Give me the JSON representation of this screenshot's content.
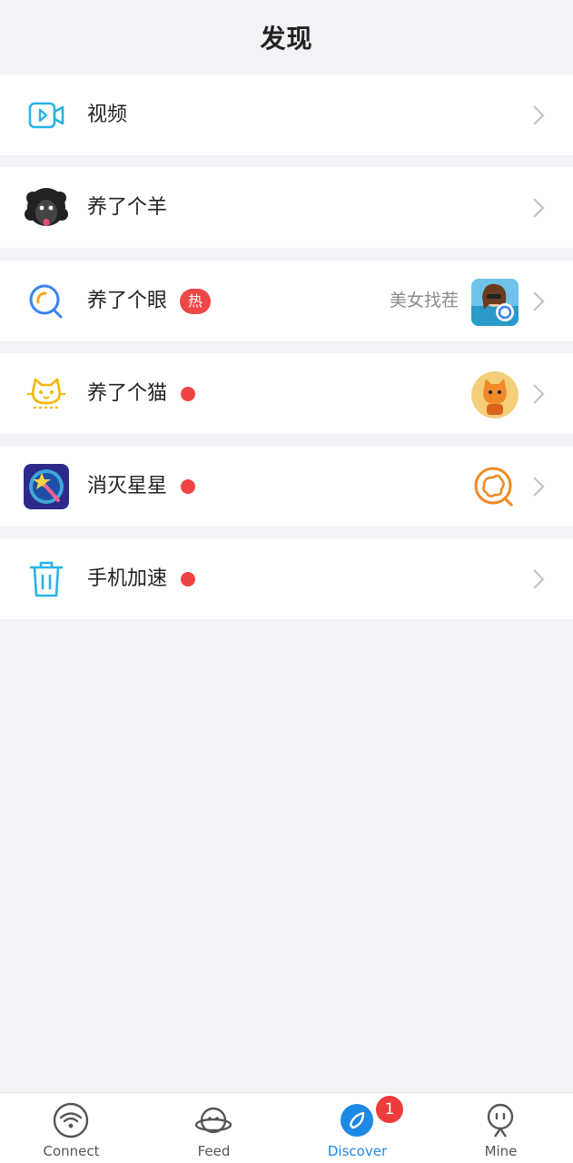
{
  "header": {
    "title": "发现"
  },
  "items": [
    {
      "label": "视频"
    },
    {
      "label": "养了个羊"
    },
    {
      "label": "养了个眼",
      "tag": "热",
      "subtitle": "美女找茬"
    },
    {
      "label": "养了个猫"
    },
    {
      "label": "消灭星星"
    },
    {
      "label": "手机加速"
    }
  ],
  "tabs": [
    {
      "label": "Connect"
    },
    {
      "label": "Feed"
    },
    {
      "label": "Discover",
      "badge": "1"
    },
    {
      "label": "Mine"
    }
  ],
  "colors": {
    "accent": "#1e88e5",
    "badge": "#ee3b3b",
    "dot": "#ef4444",
    "background": "#f2f3f7"
  }
}
